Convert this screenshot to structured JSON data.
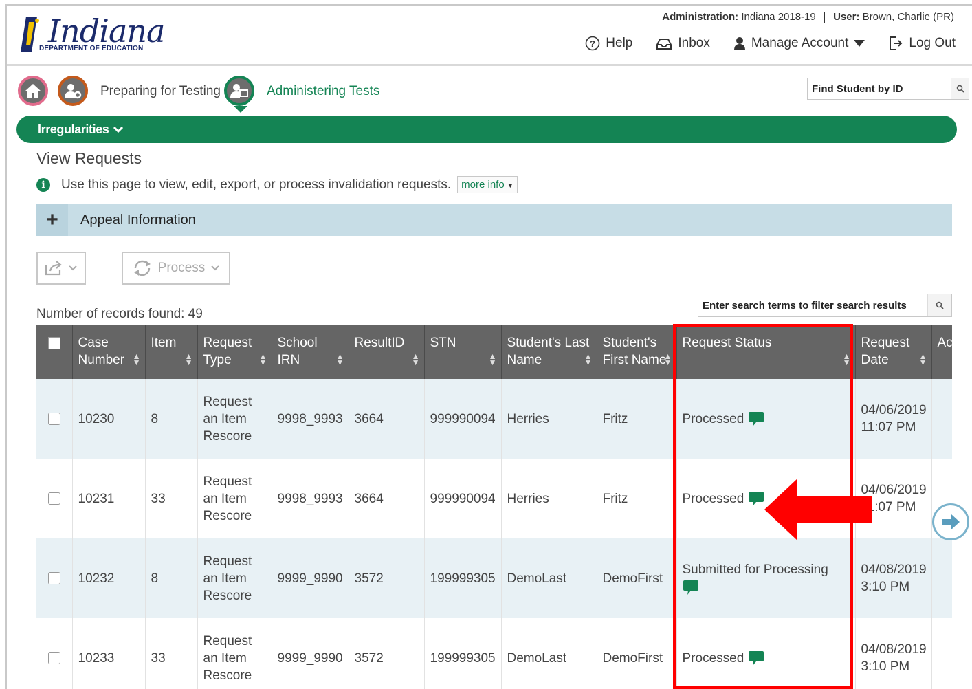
{
  "header": {
    "logo_text": "Indiana",
    "logo_subtext": "DEPARTMENT OF EDUCATION",
    "administration_label": "Administration:",
    "administration_value": "Indiana 2018-19",
    "user_label": "User:",
    "user_value": "Brown, Charlie (PR)",
    "links": {
      "help": "Help",
      "inbox": "Inbox",
      "manage_account": "Manage Account",
      "log_out": "Log Out"
    }
  },
  "nav": {
    "preparing": "Preparing for Testing",
    "administering": "Administering Tests",
    "find_student_placeholder": "Find Student by ID"
  },
  "menu_bar": {
    "label": "Irregularities"
  },
  "page": {
    "title": "View Requests",
    "info_text": "Use this page to view, edit, export, or process invalidation requests.",
    "more_info": "more info",
    "appeal_label": "Appeal Information",
    "process_label": "Process",
    "records_label": "Number of records found: 49",
    "filter_placeholder": "Enter search terms to filter search results"
  },
  "table": {
    "columns": [
      "Case Number",
      "Item",
      "Request Type",
      "School IRN",
      "ResultID",
      "STN",
      "Student's Last Name",
      "Student's First Name",
      "Request Status",
      "Request Date",
      "Ac Co"
    ],
    "rows": [
      {
        "case": "10230",
        "item": "8",
        "type": "Request an Item Rescore",
        "irn": "9998_9993",
        "result": "3664",
        "stn": "999990094",
        "last": "Herries",
        "first": "Fritz",
        "status": "Processed",
        "date": "04/06/2019 11:07 PM"
      },
      {
        "case": "10231",
        "item": "33",
        "type": "Request an Item Rescore",
        "irn": "9998_9993",
        "result": "3664",
        "stn": "999990094",
        "last": "Herries",
        "first": "Fritz",
        "status": "Processed",
        "date": "04/06/2019 11:07 PM"
      },
      {
        "case": "10232",
        "item": "8",
        "type": "Request an Item Rescore",
        "irn": "9999_9990",
        "result": "3572",
        "stn": "199999305",
        "last": "DemoLast",
        "first": "DemoFirst",
        "status": "Submitted for Processing",
        "date": "04/08/2019 3:10 PM"
      },
      {
        "case": "10233",
        "item": "33",
        "type": "Request an Item Rescore",
        "irn": "9999_9990",
        "result": "3572",
        "stn": "199999305",
        "last": "DemoLast",
        "first": "DemoFirst",
        "status": "Processed",
        "date": "04/08/2019 3:10 PM"
      }
    ]
  },
  "colors": {
    "brand_green": "#148454",
    "header_gray": "#656565",
    "row_alt": "#e8f1f5",
    "annotation_red": "#ff0000"
  }
}
